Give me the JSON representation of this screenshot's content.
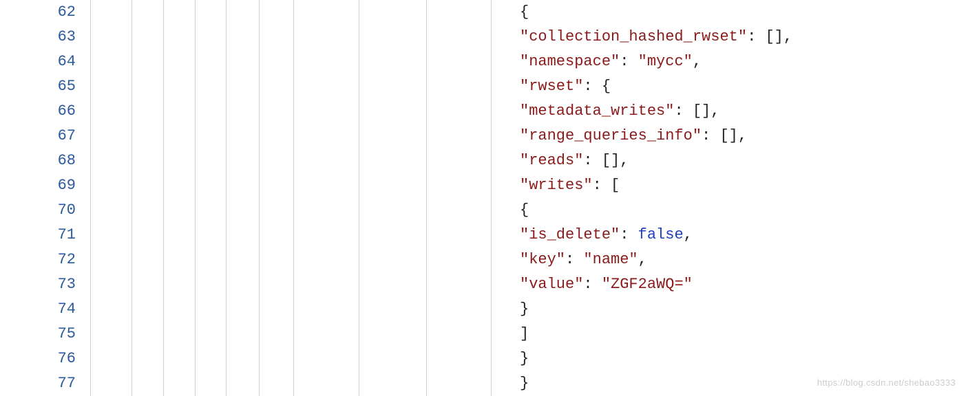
{
  "lineNumbers": [
    "62",
    "63",
    "64",
    "65",
    "66",
    "67",
    "68",
    "69",
    "70",
    "71",
    "72",
    "73",
    "74",
    "75",
    "76",
    "77"
  ],
  "indentGuideOffsets": [
    0,
    60,
    106,
    152,
    197,
    245,
    295,
    390,
    488,
    582
  ],
  "codeLines": [
    [
      {
        "t": "{",
        "c": "punct"
      }
    ],
    [
      {
        "t": "\"collection_hashed_rwset\"",
        "c": "key"
      },
      {
        "t": ": [],",
        "c": "punct"
      }
    ],
    [
      {
        "t": "\"namespace\"",
        "c": "key"
      },
      {
        "t": ": ",
        "c": "punct"
      },
      {
        "t": "\"mycc\"",
        "c": "str"
      },
      {
        "t": ",",
        "c": "punct"
      }
    ],
    [
      {
        "t": "\"rwset\"",
        "c": "key"
      },
      {
        "t": ": {",
        "c": "punct"
      }
    ],
    [
      {
        "t": "\"metadata_writes\"",
        "c": "key"
      },
      {
        "t": ": [],",
        "c": "punct"
      }
    ],
    [
      {
        "t": "\"range_queries_info\"",
        "c": "key"
      },
      {
        "t": ": [],",
        "c": "punct"
      }
    ],
    [
      {
        "t": "\"reads\"",
        "c": "key"
      },
      {
        "t": ": [],",
        "c": "punct"
      }
    ],
    [
      {
        "t": "\"writes\"",
        "c": "key"
      },
      {
        "t": ": [",
        "c": "punct"
      }
    ],
    [
      {
        "t": "{",
        "c": "punct"
      }
    ],
    [
      {
        "t": "\"is_delete\"",
        "c": "key"
      },
      {
        "t": ": ",
        "c": "punct"
      },
      {
        "t": "false",
        "c": "bool"
      },
      {
        "t": ",",
        "c": "punct"
      }
    ],
    [
      {
        "t": "\"key\"",
        "c": "key"
      },
      {
        "t": ": ",
        "c": "punct"
      },
      {
        "t": "\"name\"",
        "c": "str"
      },
      {
        "t": ",",
        "c": "punct"
      }
    ],
    [
      {
        "t": "\"value\"",
        "c": "key"
      },
      {
        "t": ": ",
        "c": "punct"
      },
      {
        "t": "\"ZGF2aWQ=\"",
        "c": "str"
      }
    ],
    [
      {
        "t": "}",
        "c": "punct"
      }
    ],
    [
      {
        "t": "]",
        "c": "punct"
      }
    ],
    [
      {
        "t": "}",
        "c": "punct"
      }
    ],
    [
      {
        "t": "}",
        "c": "punct"
      }
    ]
  ],
  "watermark": "https://blog.csdn.net/shebao3333"
}
